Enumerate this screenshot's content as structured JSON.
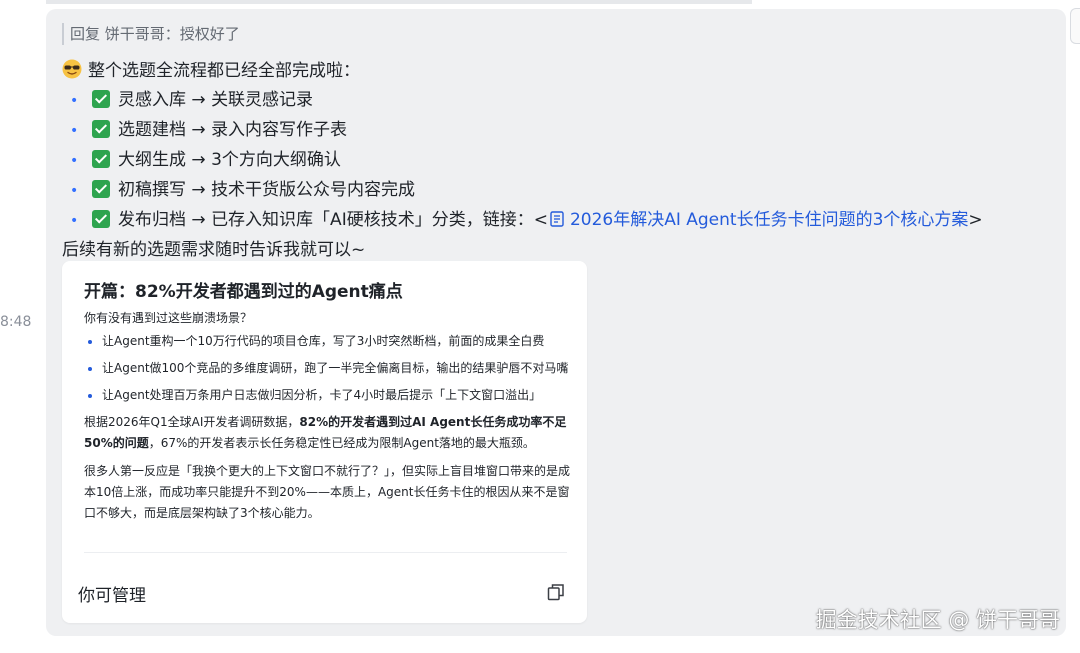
{
  "timestamp": "8:48",
  "reply": {
    "prefix": "回复",
    "text": "饼干哥哥：授权好了"
  },
  "message": {
    "intro": "整个选题全流程都已经全部完成啦：",
    "steps": [
      {
        "label": "灵感入库",
        "arrow": "→",
        "result": "关联灵感记录"
      },
      {
        "label": "选题建档",
        "arrow": "→",
        "result": "录入内容写作子表"
      },
      {
        "label": "大纲生成",
        "arrow": "→",
        "result": "3个方向大纲确认"
      },
      {
        "label": "初稿撰写",
        "arrow": "→",
        "result": "技术干货版公众号内容完成"
      }
    ],
    "last_step": {
      "label": "发布归档",
      "arrow": "→",
      "result": "已存入知识库「AI硬核技术」分类，链接：<",
      "link_text": "2026年解决AI Agent长任务卡住问题的3个核心方案",
      "suffix": ">"
    },
    "closing": "后续有新的选题需求随时告诉我就可以~"
  },
  "card": {
    "title": "开篇：82%开发者都遇到过的Agent痛点",
    "subtitle": "你有没有遇到过这些崩溃场景？",
    "bullets": [
      "让Agent重构一个10万行代码的项目仓库，写了3小时突然断档，前面的成果全白费",
      "让Agent做100个竞品的多维度调研，跑了一半完全偏离目标，输出的结果驴唇不对马嘴",
      "让Agent处理百万条用户日志做归因分析，卡了4小时最后提示「上下文窗口溢出」"
    ],
    "para1": {
      "lead": "根据2026年Q1全球AI开发者调研数据，",
      "bold": "82%的开发者遇到过AI Agent长任务成功率不足50%的问题",
      "tail": "，67%的开发者表示长任务稳定性已经成为限制Agent落地的最大瓶颈。"
    },
    "para2": "很多人第一反应是「我换个更大的上下文窗口不就行了？」，但实际上盲目堆窗口带来的是成本10倍上涨，而成功率只能提升不到20%——本质上，Agent长任务卡住的根因从来不是窗口不够大，而是底层架构缺了3个核心能力。",
    "footer": "你可管理"
  },
  "watermark": "掘金技术社区 @ 饼干哥哥",
  "colors": {
    "bubble": "#eff0f2",
    "link": "#245bdb",
    "check": "#2ea44f",
    "bullet": "#3370ff"
  },
  "icons": [
    "face-emoji-icon",
    "checkbox-icon",
    "doc-icon",
    "copy-icon"
  ]
}
